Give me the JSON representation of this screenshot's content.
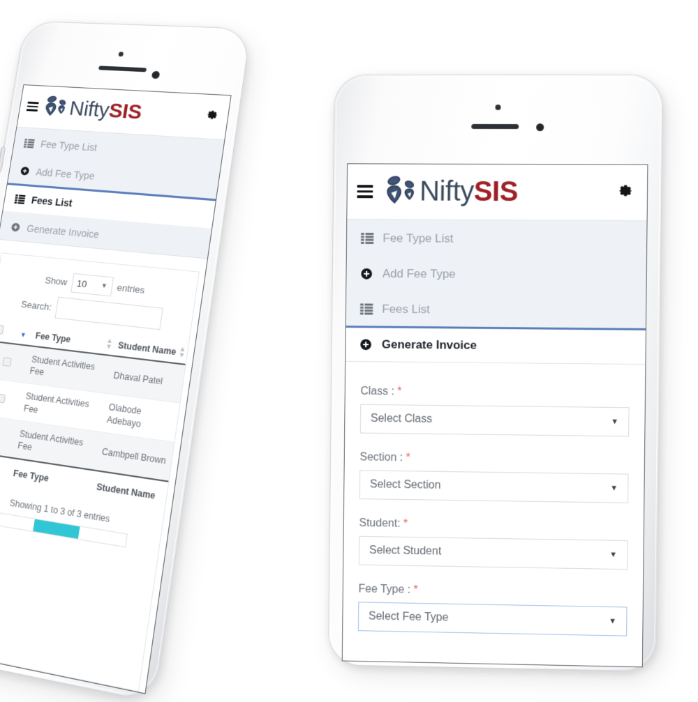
{
  "app": {
    "brand": {
      "name_part1": "Nifty",
      "name_part2": "SIS",
      "logo_icon": "people-logo-icon",
      "menu_icon": "hamburger-menu-icon",
      "settings_icon": "gear-icon"
    },
    "colors": {
      "brand_primary": "#3c4a5e",
      "brand_accent": "#9d2026",
      "active_tab_border": "#5b7fbc",
      "tab_bar_bg": "#eef1f6",
      "required_asterisk": "#e8615e",
      "expander_green": "#00b894",
      "sort_caret_blue": "#2f6fd0",
      "pager_active": "#31c6d6"
    }
  },
  "left_phone": {
    "tabs": [
      {
        "label": "Fee Type List",
        "icon": "list-icon",
        "active": false
      },
      {
        "label": "Add Fee Type",
        "icon": "plus-circle-icon",
        "active": false
      },
      {
        "label": "Fees List",
        "icon": "list-icon",
        "active": true
      },
      {
        "label": "Generate Invoice",
        "icon": "plus-circle-icon",
        "active": false
      }
    ],
    "datatable": {
      "length_label_before": "Show",
      "length_value": "10",
      "length_label_after": "entries",
      "search_label": "Search:",
      "search_value": "",
      "search_placeholder": "",
      "columns": [
        "Fee Type",
        "Student Name"
      ],
      "footer_columns": [
        "Fee Type",
        "Student Name"
      ],
      "rows": [
        {
          "fee_type": "Student Activities Fee",
          "student_name": "Dhaval Patel"
        },
        {
          "fee_type": "Student Activities Fee",
          "student_name": "Olabode Adebayo"
        },
        {
          "fee_type": "Student Activities Fee",
          "student_name": "Cambpell Brown"
        }
      ],
      "info": "Showing 1 to 3 of 3 entries"
    }
  },
  "right_phone": {
    "tabs": [
      {
        "label": "Fee Type List",
        "icon": "list-icon",
        "active": false
      },
      {
        "label": "Add Fee Type",
        "icon": "plus-circle-icon",
        "active": false
      },
      {
        "label": "Fees List",
        "icon": "list-icon",
        "active": false
      },
      {
        "label": "Generate Invoice",
        "icon": "plus-circle-icon",
        "active": true
      }
    ],
    "form": {
      "fields": [
        {
          "label": "Class :",
          "required": "*",
          "value": "Select Class",
          "focused": false
        },
        {
          "label": "Section :",
          "required": "*",
          "value": "Select Section",
          "focused": false
        },
        {
          "label": "Student:",
          "required": "*",
          "value": "Select Student",
          "focused": false
        },
        {
          "label": "Fee Type :",
          "required": "*",
          "value": "Select Fee Type",
          "focused": true
        }
      ]
    }
  }
}
